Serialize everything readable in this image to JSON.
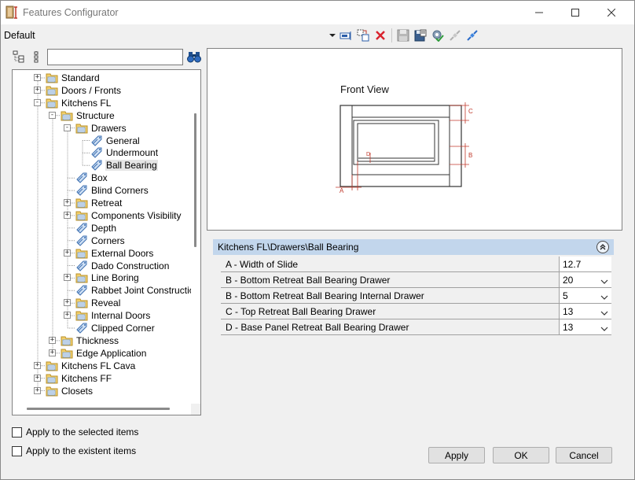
{
  "window": {
    "title": "Features Configurator"
  },
  "preset": {
    "label": "Default"
  },
  "search": {
    "value": ""
  },
  "tree": {
    "nodes": [
      {
        "label": "Standard",
        "icon": "folder-icon",
        "expander": "+"
      },
      {
        "label": "Doors / Fronts",
        "icon": "folder-icon",
        "expander": "+"
      },
      {
        "label": "Kitchens FL",
        "icon": "folder-icon",
        "expander": "-"
      },
      {
        "label": "Structure",
        "icon": "folder-icon",
        "expander": "-"
      },
      {
        "label": "Drawers",
        "icon": "folder-icon",
        "expander": "-"
      },
      {
        "label": "General",
        "icon": "tag-icon",
        "expander": ""
      },
      {
        "label": "Undermount",
        "icon": "tag-icon",
        "expander": ""
      },
      {
        "label": "Ball Bearing",
        "icon": "tag-icon",
        "expander": "",
        "selected": true
      },
      {
        "label": "Box",
        "icon": "tag-icon",
        "expander": ""
      },
      {
        "label": "Blind Corners",
        "icon": "tag-icon",
        "expander": ""
      },
      {
        "label": "Retreat",
        "icon": "folder-icon",
        "expander": "+"
      },
      {
        "label": "Components Visibility",
        "icon": "folder-icon",
        "expander": "+"
      },
      {
        "label": "Depth",
        "icon": "tag-icon",
        "expander": ""
      },
      {
        "label": "Corners",
        "icon": "tag-icon",
        "expander": ""
      },
      {
        "label": "External Doors",
        "icon": "folder-icon",
        "expander": "+"
      },
      {
        "label": "Dado Construction",
        "icon": "tag-icon",
        "expander": ""
      },
      {
        "label": "Line Boring",
        "icon": "folder-icon",
        "expander": "+"
      },
      {
        "label": "Rabbet Joint Construction",
        "icon": "tag-icon",
        "expander": ""
      },
      {
        "label": "Reveal",
        "icon": "folder-icon",
        "expander": "+"
      },
      {
        "label": "Internal Doors",
        "icon": "folder-icon",
        "expander": "+"
      },
      {
        "label": "Clipped Corner",
        "icon": "tag-icon",
        "expander": ""
      },
      {
        "label": "Thickness",
        "icon": "folder-icon",
        "expander": "+"
      },
      {
        "label": "Edge Application",
        "icon": "folder-icon",
        "expander": "+"
      },
      {
        "label": "Kitchens FL Cava",
        "icon": "folder-icon",
        "expander": "+"
      },
      {
        "label": "Kitchens FF",
        "icon": "folder-icon",
        "expander": "+"
      },
      {
        "label": "Closets",
        "icon": "folder-icon",
        "expander": "+"
      }
    ]
  },
  "options": {
    "apply_selected": "Apply to the selected items",
    "apply_existent": "Apply to the existent items"
  },
  "preview": {
    "title": "Front View",
    "labels": {
      "a": "A",
      "b": "B",
      "c": "C",
      "d": "D"
    }
  },
  "properties": {
    "path": "Kitchens FL\\Drawers\\Ball Bearing",
    "rows": [
      {
        "label": "A - Width of Slide",
        "value": "12.7",
        "dropdown": false
      },
      {
        "label": "B - Bottom Retreat Ball Bearing Drawer",
        "value": "20",
        "dropdown": true
      },
      {
        "label": "B - Bottom Retreat Ball Bearing Internal Drawer",
        "value": "5",
        "dropdown": true
      },
      {
        "label": "C - Top Retreat Ball Bearing Drawer",
        "value": "13",
        "dropdown": true
      },
      {
        "label": "D - Base Panel Retreat Ball Bearing Drawer",
        "value": "13",
        "dropdown": true
      }
    ]
  },
  "buttons": {
    "apply": "Apply",
    "ok": "OK",
    "cancel": "Cancel"
  },
  "colors": {
    "header": "#c2d6ec",
    "dimension": "#c0392b",
    "delete": "#d9232e"
  }
}
